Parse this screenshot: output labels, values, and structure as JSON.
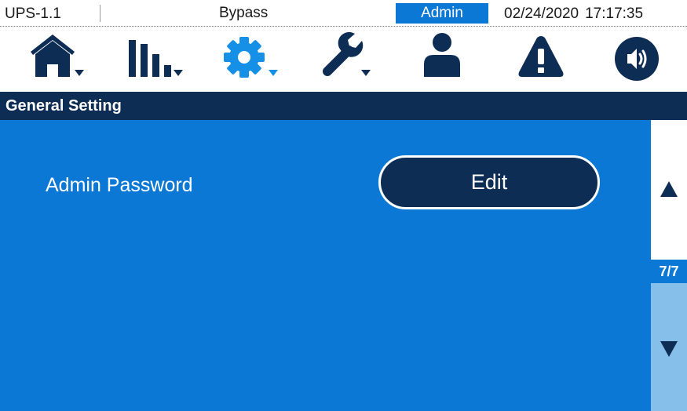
{
  "status_bar": {
    "device": "UPS-1.1",
    "mode": "Bypass",
    "user": "Admin",
    "date": "02/24/2020",
    "time": "17:17:35"
  },
  "toolbar": {
    "items": [
      {
        "name": "home-icon",
        "has_dropdown": true
      },
      {
        "name": "measurements-icon",
        "has_dropdown": true
      },
      {
        "name": "settings-gear-icon",
        "has_dropdown": true,
        "active": true
      },
      {
        "name": "wrench-icon",
        "has_dropdown": true
      },
      {
        "name": "user-icon",
        "has_dropdown": false
      },
      {
        "name": "alarm-warning-icon",
        "has_dropdown": false
      },
      {
        "name": "speaker-icon",
        "has_dropdown": false
      }
    ]
  },
  "section": {
    "title": "General Setting"
  },
  "settings": [
    {
      "label": "Admin Password",
      "action": "Edit"
    }
  ],
  "pagination": {
    "current": 7,
    "total": 7,
    "label": "7/7"
  },
  "colors": {
    "navy": "#0e2d55",
    "blue": "#0b78d6",
    "light_blue": "#86c0ea",
    "active_icon": "#1590e6"
  }
}
